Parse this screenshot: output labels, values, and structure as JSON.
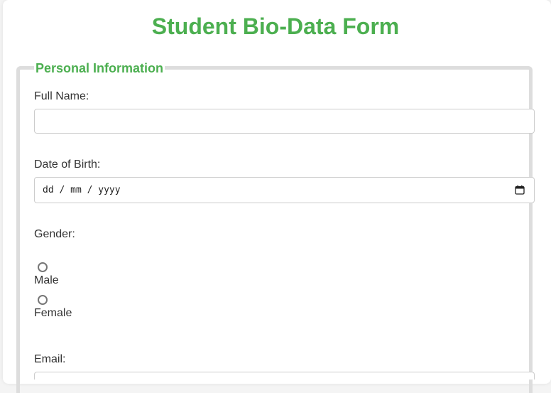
{
  "title": "Student Bio-Data Form",
  "colors": {
    "accent": "#4caf50",
    "border": "#dddddd",
    "input_border": "#cccccc",
    "text": "#333333"
  },
  "personal_info": {
    "legend": "Personal Information",
    "full_name": {
      "label": "Full Name:",
      "value": ""
    },
    "dob": {
      "label": "Date of Birth:",
      "placeholder": "dd / mm / yyyy"
    },
    "gender": {
      "label": "Gender:",
      "options": [
        "Male",
        "Female"
      ]
    },
    "email": {
      "label": "Email:",
      "value": ""
    }
  },
  "icons": {
    "date_picker": "calendar-icon"
  }
}
